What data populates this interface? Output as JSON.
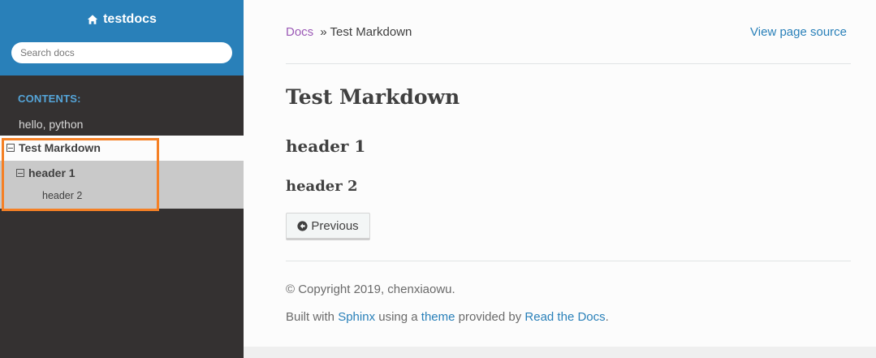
{
  "sidebar": {
    "project_name": "testdocs",
    "search_placeholder": "Search docs",
    "caption": "CONTENTS:",
    "items": [
      {
        "label": "hello, python"
      },
      {
        "label": "Test Markdown"
      },
      {
        "label": "header 1"
      },
      {
        "label": "header 2"
      }
    ]
  },
  "breadcrumb": {
    "root": "Docs",
    "separator": "»",
    "current": "Test Markdown"
  },
  "view_source": "View page source",
  "main": {
    "title": "Test Markdown",
    "heading_1": "header 1",
    "heading_2": "header 2",
    "previous_button": "Previous"
  },
  "footer": {
    "copyright": "© Copyright 2019, chenxiaowu.",
    "built_prefix": "Built with",
    "sphinx": "Sphinx",
    "using_a": "using a",
    "theme": "theme",
    "provided_by": "provided by",
    "rtd": "Read the Docs",
    "period": "."
  },
  "colors": {
    "sidebar_top": "#2980b9",
    "sidebar_bg": "#343131",
    "highlight_box": "#f58025",
    "link": "#2980b9",
    "visited_link": "#9b59b6"
  }
}
